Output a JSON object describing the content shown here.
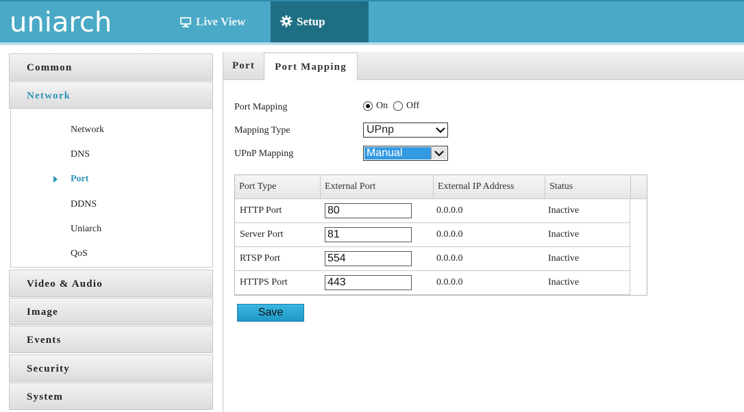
{
  "header": {
    "logo": "uniarch",
    "nav": [
      {
        "label": "Live View",
        "icon": "monitor-icon"
      },
      {
        "label": "Setup",
        "icon": "gear-icon"
      }
    ]
  },
  "sidebar": {
    "menus": [
      {
        "label": "Common"
      },
      {
        "label": "Network"
      },
      {
        "label": "Video & Audio"
      },
      {
        "label": "Image"
      },
      {
        "label": "Events"
      },
      {
        "label": "Security"
      },
      {
        "label": "System"
      }
    ],
    "network_items": [
      {
        "label": "Network"
      },
      {
        "label": "DNS"
      },
      {
        "label": "Port"
      },
      {
        "label": "DDNS"
      },
      {
        "label": "Uniarch"
      },
      {
        "label": "QoS"
      }
    ],
    "active_item": "Port"
  },
  "tabs": [
    {
      "label": "Port"
    },
    {
      "label": "Port Mapping"
    }
  ],
  "form": {
    "port_mapping": {
      "label": "Port Mapping",
      "on_label": "On",
      "off_label": "Off",
      "selected": "On"
    },
    "mapping_type": {
      "label": "Mapping Type",
      "value": "UPnp"
    },
    "upnp_mapping": {
      "label": "UPnP Mapping",
      "value": "Manual"
    }
  },
  "table": {
    "headers": [
      "Port Type",
      "External Port",
      "External IP Address",
      "Status"
    ],
    "rows": [
      {
        "port_type": "HTTP Port",
        "external_port": "80",
        "external_ip": "0.0.0.0",
        "status": "Inactive"
      },
      {
        "port_type": "Server Port",
        "external_port": "81",
        "external_ip": "0.0.0.0",
        "status": "Inactive"
      },
      {
        "port_type": "RTSP Port",
        "external_port": "554",
        "external_ip": "0.0.0.0",
        "status": "Inactive"
      },
      {
        "port_type": "HTTPS Port",
        "external_port": "443",
        "external_ip": "0.0.0.0",
        "status": "Inactive"
      }
    ]
  },
  "save_label": "Save",
  "colors": {
    "header_bg": "#4aa9c6",
    "setup_tab_bg": "#1f6f84",
    "accent": "#2c95b8",
    "save_button": "#2aa7d6"
  }
}
